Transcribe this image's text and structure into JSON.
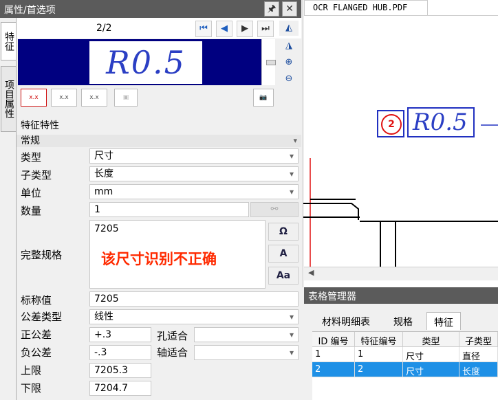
{
  "window": {
    "title": "属性/首选项",
    "pin": "🖈",
    "close": "✕"
  },
  "vertical_tabs": [
    "特征",
    "项目属性"
  ],
  "nav": {
    "page": "2/2"
  },
  "preview": {
    "text": "R0.5"
  },
  "props": {
    "header": "特征特性",
    "group": "常规",
    "rows": {
      "type": {
        "label": "类型",
        "value": "尺寸"
      },
      "subtype": {
        "label": "子类型",
        "value": "长度"
      },
      "unit": {
        "label": "单位",
        "value": "mm"
      },
      "qty": {
        "label": "数量",
        "value": "1"
      },
      "full_spec": {
        "label": "完整规格",
        "value": "7205"
      },
      "nominal": {
        "label": "标称值",
        "value": "7205"
      },
      "tol_type": {
        "label": "公差类型",
        "value": "线性"
      },
      "plus_tol": {
        "label": "正公差",
        "value": "+.3"
      },
      "minus_tol": {
        "label": "负公差",
        "value": "-.3"
      },
      "hole_fit": {
        "label": "孔适合",
        "value": ""
      },
      "shaft_fit": {
        "label": "轴适合",
        "value": ""
      },
      "upper": {
        "label": "上限",
        "value": "7205.3"
      },
      "lower": {
        "label": "下限",
        "value": "7204.7"
      }
    },
    "annotation": "该尺寸识别不正确"
  },
  "document": {
    "tab": "OCR FLANGED HUB.PDF",
    "balloon": "2",
    "dimension": "R0.5"
  },
  "table_manager": {
    "title": "表格管理器",
    "tabs": [
      "材料明细表",
      "规格",
      "特征"
    ],
    "columns": [
      "ID 编号",
      "特征编号",
      "类型",
      "子类型"
    ],
    "rows": [
      [
        "1",
        "1",
        "尺寸",
        "直径"
      ],
      [
        "2",
        "2",
        "尺寸",
        "长度"
      ]
    ]
  },
  "colors": {
    "accent": "#000080",
    "selection": "#1e90e6",
    "annotation": "#ff2a00"
  }
}
